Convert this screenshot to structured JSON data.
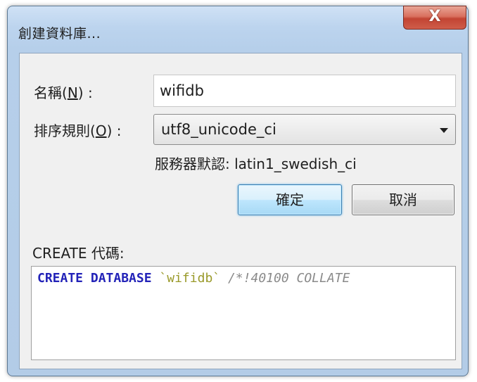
{
  "window": {
    "title": "創建資料庫...",
    "close_label": "X"
  },
  "form": {
    "name_label_prefix": "名稱(",
    "name_label_key": "N",
    "name_label_suffix": ") :",
    "name_value": "wifidb",
    "collation_label_prefix": "排序規則(",
    "collation_label_key": "O",
    "collation_label_suffix": ") :",
    "collation_value": "utf8_unicode_ci",
    "server_default": "服務器默認: latin1_swedish_ci"
  },
  "buttons": {
    "ok_label": "確定",
    "cancel_label": "取消"
  },
  "code": {
    "label": "CREATE 代碼:",
    "kw1": "CREATE",
    "kw2": "DATABASE",
    "ident": "`wifidb`",
    "comment": "/*!40100 COLLATE"
  },
  "colors": {
    "keyword": "#2323b8",
    "identifier": "#9a9a2a",
    "comment": "#8a8a8a",
    "close_button": "#c24433"
  }
}
